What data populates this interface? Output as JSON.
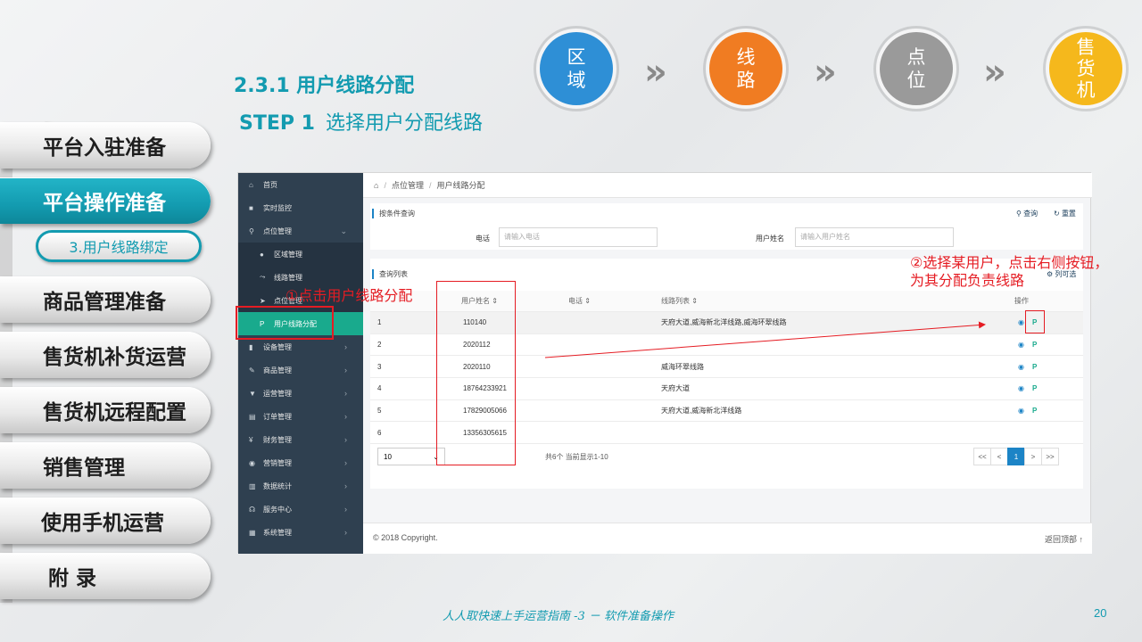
{
  "slide": {
    "section_title": "2.3.1 用户线路分配",
    "step_label": "STEP 1",
    "step_text": "选择用户分配线路",
    "footer": "人人取快速上手运营指南 -3 － 软件准备操作",
    "page_number": "20"
  },
  "slide_nav": {
    "items": [
      {
        "label": "平台入驻准备",
        "active": false
      },
      {
        "label": "平台操作准备",
        "active": true
      },
      {
        "label": "商品管理准备",
        "active": false
      },
      {
        "label": "售货机补货运营",
        "active": false
      },
      {
        "label": "售货机远程配置",
        "active": false
      },
      {
        "label": "销售管理",
        "active": false
      },
      {
        "label": "使用手机运营",
        "active": false
      },
      {
        "label": "附 录",
        "active": false
      }
    ],
    "sub_item": "3.用户线路绑定"
  },
  "steps": [
    {
      "label": "区域",
      "color": "#2e8fd6"
    },
    {
      "label": "线路",
      "color": "#f07c22"
    },
    {
      "label": "点位",
      "color": "#9a9a9a"
    },
    {
      "label": "售货机",
      "color": "#f5b81c"
    }
  ],
  "colors": {
    "accent": "#139bb0",
    "annotation": "#e51c23",
    "app_sidebar": "#2f4050",
    "app_active": "#19aa8d",
    "pager_active": "#1c84c6"
  },
  "app": {
    "sidebar": [
      {
        "icon": "home-icon",
        "glyph": "⌂",
        "label": "首页",
        "arrow": ""
      },
      {
        "icon": "video-icon",
        "glyph": "■",
        "label": "实时监控",
        "arrow": ""
      },
      {
        "icon": "location-icon",
        "glyph": "⚲",
        "label": "点位管理",
        "arrow": "⌄"
      },
      {
        "icon": "globe-icon",
        "glyph": "●",
        "label": "区域管理",
        "arrow": ""
      },
      {
        "icon": "route-icon",
        "glyph": "⤳",
        "label": "线路管理",
        "arrow": ""
      },
      {
        "icon": "navigate-icon",
        "glyph": "➤",
        "label": "点位管理",
        "arrow": ""
      },
      {
        "icon": "user-route-icon",
        "glyph": "P",
        "label": "用户线路分配",
        "arrow": ""
      },
      {
        "icon": "device-icon",
        "glyph": "▮",
        "label": "设备管理",
        "arrow": "›"
      },
      {
        "icon": "edit-icon",
        "glyph": "✎",
        "label": "商品管理",
        "arrow": "›"
      },
      {
        "icon": "bookmark-icon",
        "glyph": "▼",
        "label": "运营管理",
        "arrow": "›"
      },
      {
        "icon": "order-icon",
        "glyph": "▤",
        "label": "订单管理",
        "arrow": "›"
      },
      {
        "icon": "yen-icon",
        "glyph": "¥",
        "label": "财务管理",
        "arrow": "›"
      },
      {
        "icon": "marketing-icon",
        "glyph": "◉",
        "label": "营销管理",
        "arrow": "›"
      },
      {
        "icon": "chart-icon",
        "glyph": "▥",
        "label": "数据统计",
        "arrow": "›"
      },
      {
        "icon": "headset-icon",
        "glyph": "☊",
        "label": "服务中心",
        "arrow": "›"
      },
      {
        "icon": "system-icon",
        "glyph": "▦",
        "label": "系统管理",
        "arrow": "›"
      }
    ],
    "breadcrumb": [
      "点位管理",
      "用户线路分配"
    ],
    "search": {
      "title": "按条件查询",
      "query_label": "查询",
      "reset_label": "重置",
      "phone_label": "电话",
      "phone_placeholder": "请输入电话",
      "name_label": "用户姓名",
      "name_placeholder": "请输入用户姓名"
    },
    "list": {
      "title": "查询列表",
      "column_select": "列可选",
      "columns": [
        "",
        "用户姓名 ⇕",
        "电话 ⇕",
        "线路列表 ⇕",
        "操作"
      ],
      "rows": [
        {
          "no": "1",
          "name": "110140",
          "phone": "",
          "routes": "天府大道,威海新北洋线路,威海环翠线路"
        },
        {
          "no": "2",
          "name": "2020112",
          "phone": "",
          "routes": ""
        },
        {
          "no": "3",
          "name": "2020110",
          "phone": "",
          "routes": "威海环翠线路"
        },
        {
          "no": "4",
          "name": "18764233921",
          "phone": "",
          "routes": "天府大道"
        },
        {
          "no": "5",
          "name": "17829005066",
          "phone": "",
          "routes": "天府大道,威海新北洋线路"
        },
        {
          "no": "6",
          "name": "13356305615",
          "phone": "",
          "routes": ""
        }
      ]
    },
    "pager": {
      "page_size": "10",
      "info": "共6个 当前显示1-10",
      "buttons": [
        "<<",
        "<",
        "1",
        ">",
        ">>"
      ]
    },
    "footer": {
      "copyright": "© 2018 Copyright.",
      "back_to_top": "返回顶部"
    }
  },
  "annotations": {
    "step1": "①点击用户线路分配",
    "step2_line1": "②选择某用户，点击右侧按钮，",
    "step2_line2": "为其分配负责线路"
  }
}
